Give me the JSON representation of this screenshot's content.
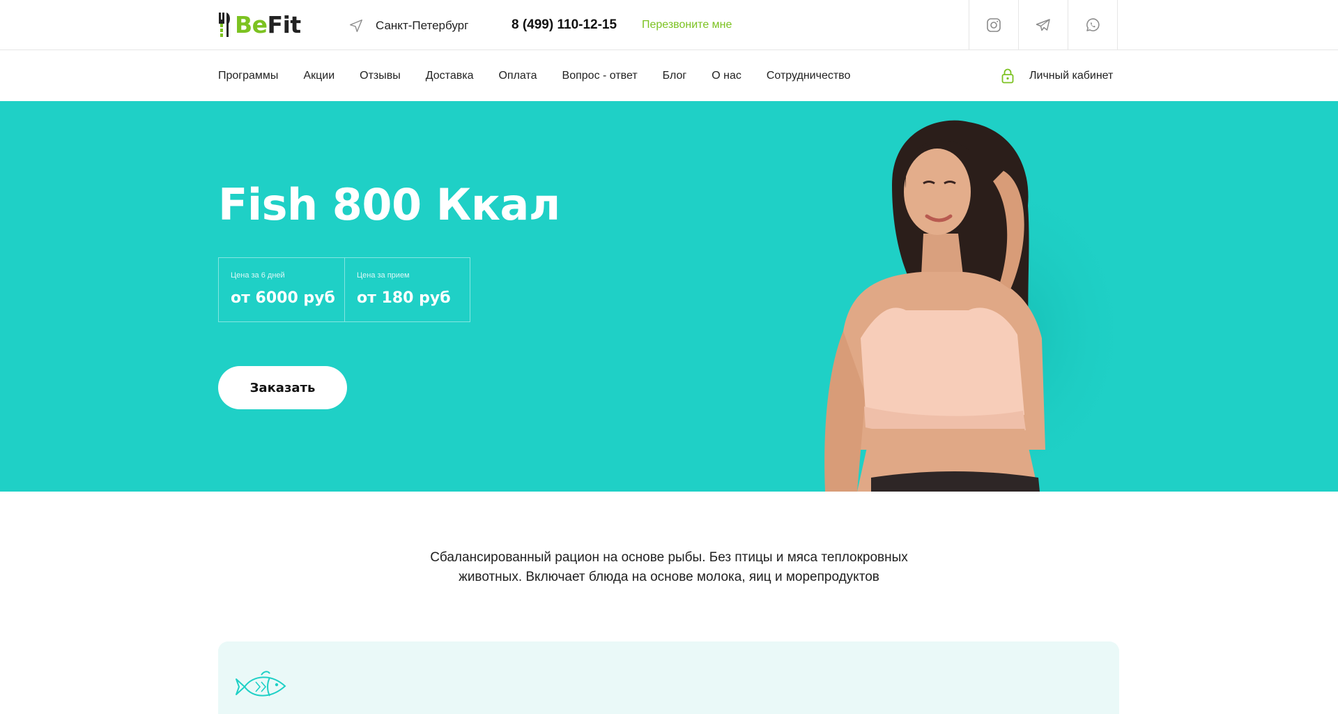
{
  "header": {
    "logo": {
      "part1": "Be",
      "part2": "Fit"
    },
    "city": "Санкт-Петербург",
    "phone": "8 (499) 110-12-15",
    "callback": "Перезвоните мне",
    "socials": [
      "instagram-icon",
      "telegram-icon",
      "whatsapp-icon"
    ]
  },
  "nav": {
    "items": [
      "Программы",
      "Акции",
      "Отзывы",
      "Доставка",
      "Оплата",
      "Вопрос - ответ",
      "Блог",
      "О нас",
      "Сотрудничество"
    ],
    "cabinet": "Личный кабинет"
  },
  "hero": {
    "title": "Fish 800 Ккал",
    "prices": [
      {
        "label": "Цена за 6 дней",
        "value": "от 6000 руб"
      },
      {
        "label": "Цена за прием",
        "value": "от 180 руб"
      }
    ],
    "order_button": "Заказать"
  },
  "description": {
    "line1": "Сбалансированный рацион на основе рыбы. Без птицы и мяса теплокровных",
    "line2": "животных. Включает блюда на основе молока, яиц и морепродуктов"
  },
  "feature_icon": "fish-icon",
  "colors": {
    "accent_green": "#7cc221",
    "hero_bg": "#1fd0c6",
    "card_bg": "#eaf9f8"
  }
}
